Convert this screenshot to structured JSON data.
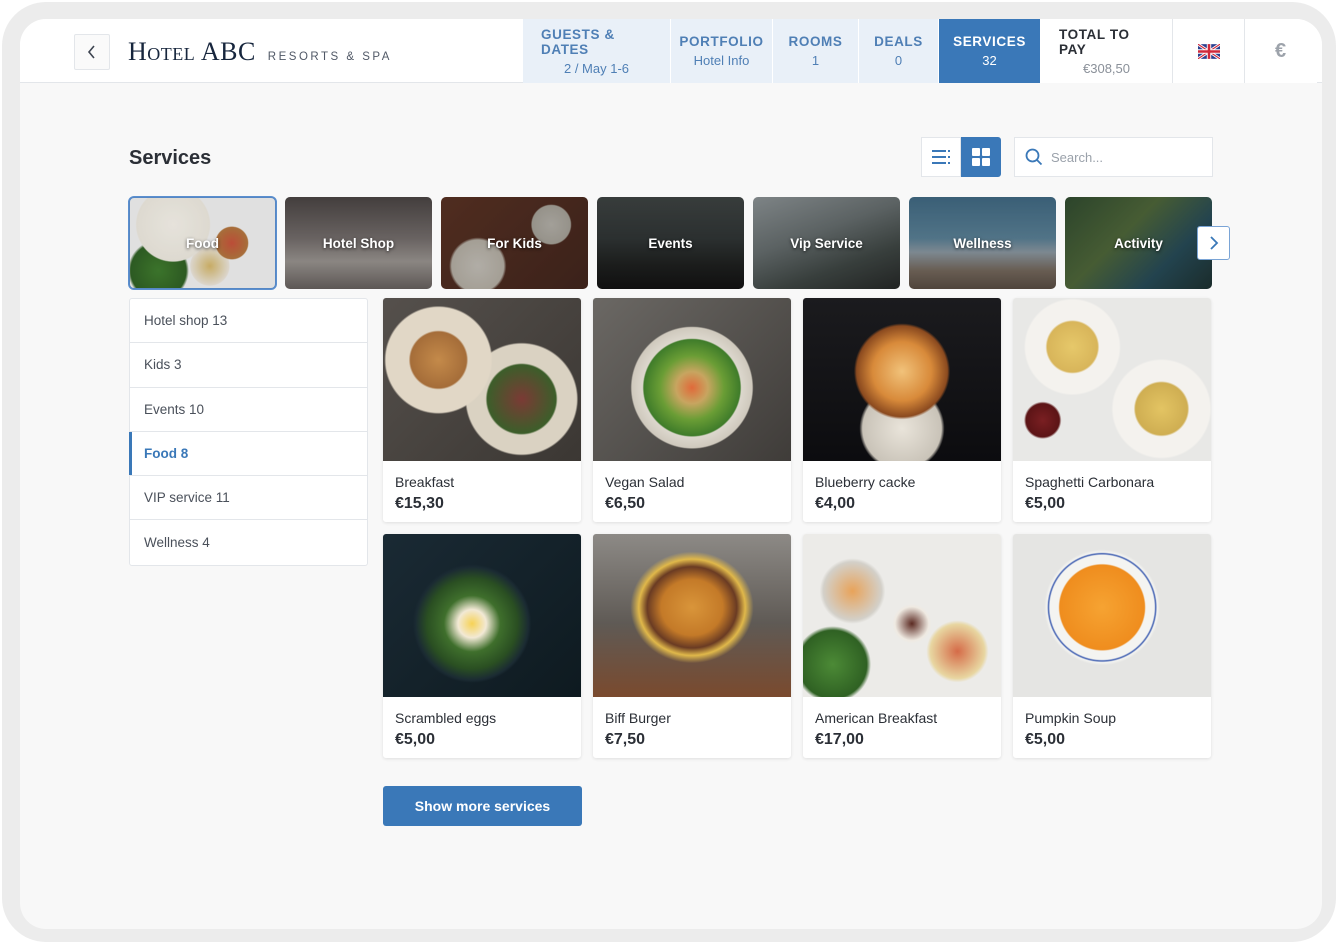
{
  "header": {
    "back_icon": "chevron-left-icon",
    "logo_main": "Hotel ABC",
    "logo_sub": "RESORTS & SPA",
    "nav": [
      {
        "label": "GUESTS & DATES",
        "value": "2 / May 1-6"
      },
      {
        "label": "PORTFOLIO",
        "value": "Hotel Info"
      },
      {
        "label": "ROOMS",
        "value": "1"
      },
      {
        "label": "DEALS",
        "value": "0"
      },
      {
        "label": "SERVICES",
        "value": "32",
        "active": true
      }
    ],
    "total": {
      "label": "TOTAL TO PAY",
      "value": "€308,50"
    },
    "language_icon": "uk-flag-icon",
    "currency_symbol": "€"
  },
  "main": {
    "title": "Services",
    "view_modes": {
      "list_icon": "list-view-icon",
      "grid_icon": "grid-view-icon",
      "active": "grid"
    },
    "search": {
      "placeholder": "Search...",
      "value": ""
    },
    "categories": [
      {
        "label": "Food",
        "active": true
      },
      {
        "label": "Hotel Shop"
      },
      {
        "label": "For Kids"
      },
      {
        "label": "Events"
      },
      {
        "label": "Vip Service"
      },
      {
        "label": "Wellness"
      },
      {
        "label": "Activity"
      }
    ],
    "next_icon": "chevron-right-icon",
    "sidebar": [
      {
        "label": "Hotel shop 13"
      },
      {
        "label": "Kids 3"
      },
      {
        "label": "Events 10"
      },
      {
        "label": "Food 8",
        "active": true
      },
      {
        "label": "VIP service 11"
      },
      {
        "label": "Wellness 4"
      }
    ],
    "items": [
      {
        "name": "Breakfast",
        "price": "€15,30"
      },
      {
        "name": "Vegan Salad",
        "price": "€6,50"
      },
      {
        "name": "Blueberry cacke",
        "price": "€4,00"
      },
      {
        "name": "Spaghetti Carbonara",
        "price": "€5,00"
      },
      {
        "name": "Scrambled eggs",
        "price": "€5,00"
      },
      {
        "name": "Biff Burger",
        "price": "€7,50"
      },
      {
        "name": "American Breakfast",
        "price": "€17,00"
      },
      {
        "name": "Pumpkin Soup",
        "price": "€5,00"
      }
    ],
    "show_more_label": "Show more services"
  },
  "colors": {
    "accent": "#3a78b8",
    "nav_bg": "#e9f0f8",
    "text": "#2b2f36"
  }
}
